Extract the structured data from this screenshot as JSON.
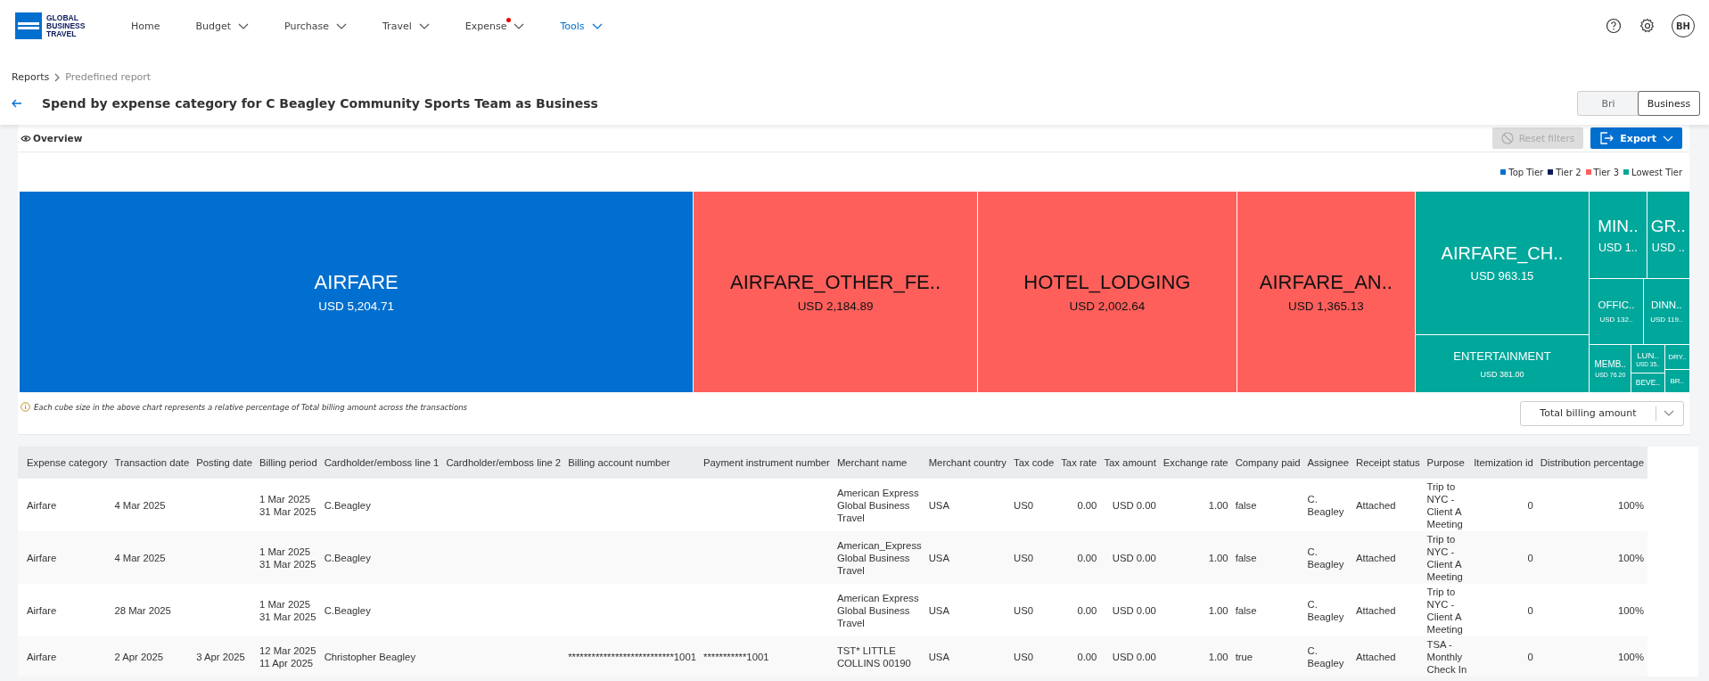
{
  "nav": {
    "brand_lines": [
      "GLOBAL",
      "BUSINESS",
      "TRAVEL"
    ],
    "items": [
      {
        "label": "Home",
        "menu": false,
        "alert": false,
        "selected": false
      },
      {
        "label": "Budget",
        "menu": true,
        "alert": false,
        "selected": false
      },
      {
        "label": "Purchase",
        "menu": true,
        "alert": false,
        "selected": false
      },
      {
        "label": "Travel",
        "menu": true,
        "alert": false,
        "selected": false
      },
      {
        "label": "Expense",
        "menu": true,
        "alert": true,
        "selected": false
      },
      {
        "label": "Tools",
        "menu": true,
        "alert": false,
        "selected": true
      }
    ],
    "user_initials": "BH"
  },
  "breadcrumb": [
    {
      "label": "Reports",
      "current": false
    },
    {
      "label": "Predefined report",
      "current": true
    }
  ],
  "title": "Spend by expense category for C Beagley Community Sports Team as Business",
  "view_toggle": [
    {
      "label": "Bri",
      "selected": false
    },
    {
      "label": "Business",
      "selected": true
    }
  ],
  "overview": {
    "label": "Overview",
    "reset_button": {
      "label": "Reset filters",
      "disabled": true
    },
    "export_button": {
      "label": "Export"
    }
  },
  "legend": [
    {
      "label": "Top Tier",
      "color": "#006fcf"
    },
    {
      "label": "Tier 2",
      "color": "#0b1a5c"
    },
    {
      "label": "Tier 3",
      "color": "#ff5f5b"
    },
    {
      "label": "Lowest Tier",
      "color": "#00a79b"
    }
  ],
  "treemap": {
    "tiles": [
      {
        "label": "AIRFARE",
        "value": "USD 5,204.71",
        "color": "#006fcf"
      },
      {
        "label": "AIRFARE_OTHER_FE..",
        "value": "USD 2,184.89",
        "color": "#ff5f5b"
      },
      {
        "label": "HOTEL_LODGING",
        "value": "USD 2,002.64",
        "color": "#ff5f5b"
      },
      {
        "label": "AIRFARE_AN..",
        "value": "USD 1,365.13",
        "color": "#ff5f5b"
      },
      {
        "label": "AIRFARE_CH..",
        "value": "USD 963.15",
        "color": "#00a79b"
      },
      {
        "label": "ENTERTAINMENT",
        "value": "USD 381.00",
        "color": "#00a79b"
      },
      {
        "label": "MIN..",
        "value": "USD 1..",
        "color": "#00a79b"
      },
      {
        "label": "GR..",
        "value": "USD ..",
        "color": "#00a79b"
      },
      {
        "label": "OFFIC..",
        "value": "USD 132..",
        "color": "#00a79b"
      },
      {
        "label": "DINN..",
        "value": "USD 119..",
        "color": "#00a79b"
      },
      {
        "label": "MEMB..",
        "value": "USD 76.20",
        "color": "#00a79b"
      },
      {
        "label": "LUN..",
        "value": "USD 35..",
        "color": "#00a79b"
      },
      {
        "label": "BEVE..",
        "color": "#00a79b"
      },
      {
        "label": "DRY..",
        "color": "#00a79b"
      },
      {
        "label": "BR..",
        "color": "#00a79b"
      }
    ]
  },
  "note": "Each cube size in the above chart represents a relative percentage of Total billing amount across the transactions",
  "measure_select": {
    "value": "Total billing amount"
  },
  "table": {
    "columns": [
      "Expense category",
      "Transaction date",
      "Posting date",
      "Billing period",
      "Cardholder/emboss line 1",
      "Cardholder/emboss line 2",
      "Billing account number",
      "Payment instrument number",
      "Merchant name",
      "Merchant country",
      "Tax code",
      "Tax rate",
      "Tax amount",
      "Exchange rate",
      "Company paid",
      "Assignee",
      "Receipt status",
      "Purpose",
      "Itemization id",
      "Distribution percentage"
    ],
    "rows": [
      [
        "Airfare",
        "4 Mar 2025",
        null,
        "1 Mar 2025\n31 Mar 2025",
        "C.Beagley",
        null,
        null,
        null,
        "American Express\nGlobal Business\nTravel",
        "USA",
        "US0",
        "0.00",
        "USD 0.00",
        "1.00",
        "false",
        "C.\nBeagley",
        "Attached",
        "Trip to\nNYC -\nClient A\nMeeting",
        "0",
        "100%"
      ],
      [
        "Airfare",
        "4 Mar 2025",
        null,
        "1 Mar 2025\n31 Mar 2025",
        "C.Beagley",
        null,
        null,
        null,
        "American_Express\nGlobal Business\nTravel",
        "USA",
        "US0",
        "0.00",
        "USD 0.00",
        "1.00",
        "false",
        "C.\nBeagley",
        "Attached",
        "Trip to\nNYC -\nClient A\nMeeting",
        "0",
        "100%"
      ],
      [
        "Airfare",
        "28 Mar 2025",
        null,
        "1 Mar 2025\n31 Mar 2025",
        "C.Beagley",
        null,
        null,
        null,
        "American Express\nGlobal Business\nTravel",
        "USA",
        "US0",
        "0.00",
        "USD 0.00",
        "1.00",
        "false",
        "C.\nBeagley",
        "Attached",
        "Trip to\nNYC -\nClient A\nMeeting",
        "0",
        "100%"
      ],
      [
        "Airfare",
        "2 Apr 2025",
        "3 Apr 2025",
        "12 Mar 2025\n11 Apr 2025",
        "Christopher Beagley",
        null,
        "***************************1001",
        "***********1001",
        "TST* LITTLE\nCOLLINS 00190",
        "USA",
        "US0",
        "0.00",
        "USD 0.00",
        "1.00",
        "true",
        "C.\nBeagley",
        "Attached",
        "TSA -\nMonthly\nCheck In",
        "0",
        "100%"
      ]
    ]
  }
}
